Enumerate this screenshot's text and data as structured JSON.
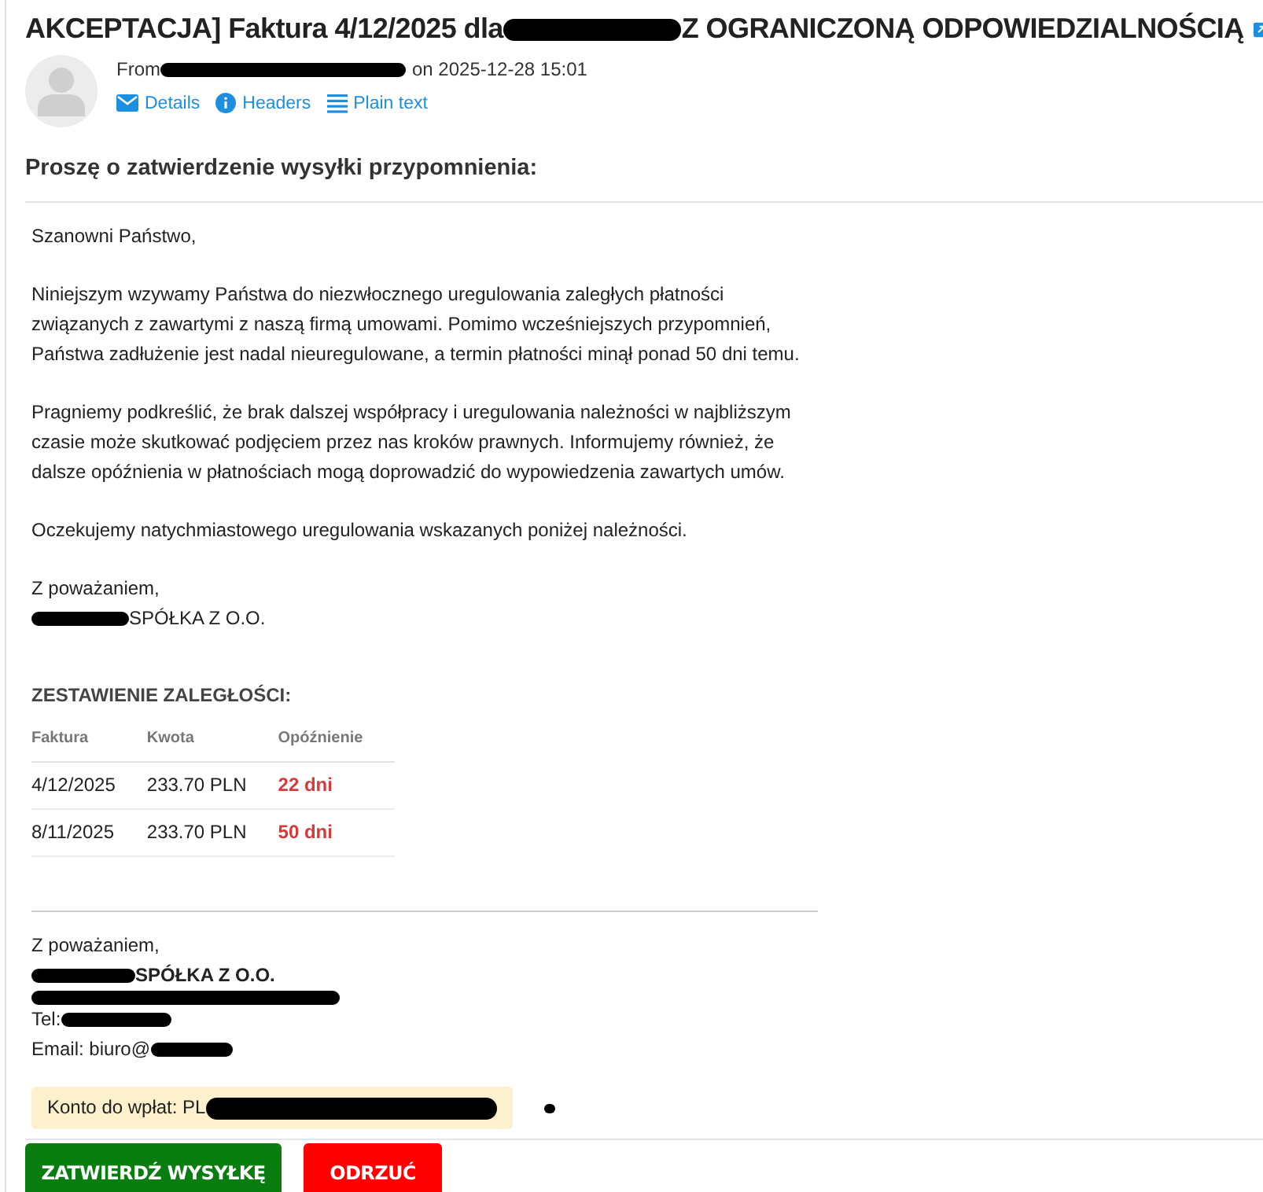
{
  "subject": {
    "before": "AKCEPTACJA] Faktura 4/12/2025 dla",
    "after": "Z OGRANICZONĄ ODPOWIEDZIALNOŚCIĄ"
  },
  "sender": {
    "from_label": "From",
    "date": "on 2025-12-28 15:01"
  },
  "header_links": [
    {
      "kind": "details",
      "label": "Details"
    },
    {
      "kind": "headers",
      "label": "Headers"
    },
    {
      "kind": "plain",
      "label": "Plain text"
    }
  ],
  "heading": "Proszę o zatwierdzenie wysyłki przypomnienia:",
  "greeting": "Szanowni Państwo,",
  "paragraphs": [
    "Niniejszym wzywamy Państwa do niezwłocznego uregulowania zaległych płatności związanych z zawartymi z naszą firmą umowami. Pomimo wcześniejszych przypomnień, Państwa zadłużenie jest nadal nieuregulowane, a termin płatności minął ponad 50 dni temu.",
    "Pragniemy podkreślić, że brak dalszej współpracy i uregulowania należności w najbliższym czasie może skutkować podjęciem przez nas kroków prawnych. Informujemy również, że dalsze opóźnienia w płatnościach mogą doprowadzić do wypowiedzenia zawartych umów.",
    "Oczekujemy natychmiastowego uregulowania wskazanych poniżej należności."
  ],
  "closing": "Z poważaniem,",
  "company": "SPÓŁKA Z O.O.",
  "summary_title": "ZESTAWIENIE ZALEGŁOŚCI:",
  "table": {
    "columns": [
      "Faktura",
      "Kwota",
      "Opóźnienie"
    ],
    "rows": [
      [
        "4/12/2025",
        "233.70 PLN",
        "22 dni"
      ],
      [
        "8/11/2025",
        "233.70 PLN",
        "50 dni"
      ]
    ]
  },
  "signature": {
    "closing": "Z poważaniem,",
    "company": "SPÓŁKA Z O.O.",
    "tel": "Tel:",
    "email": "Email: biuro@"
  },
  "account": "Konto do wpłat: PL",
  "buttons": [
    {
      "kind": "approve",
      "label": "ZATWIERDŹ WYSYŁKĘ"
    },
    {
      "kind": "reject",
      "label": "ODRZUĆ"
    }
  ]
}
